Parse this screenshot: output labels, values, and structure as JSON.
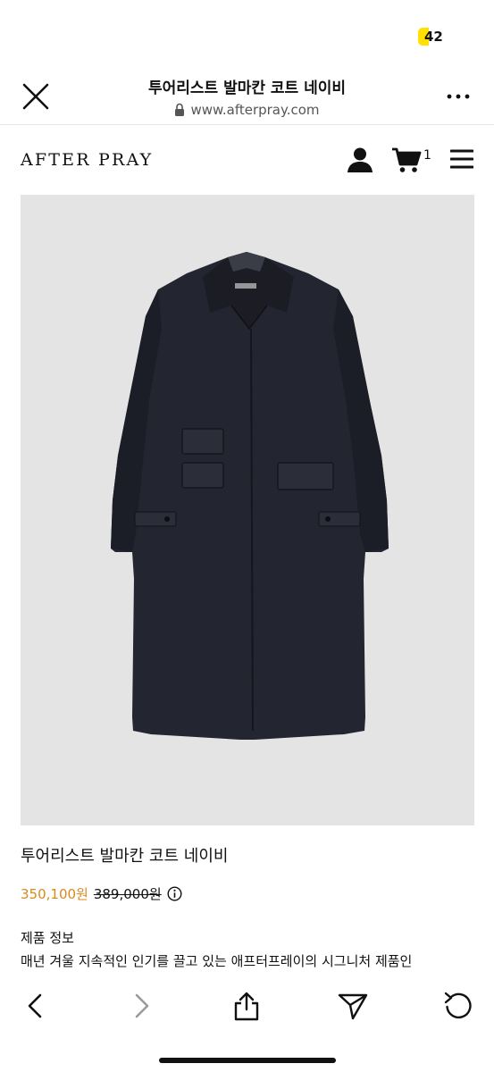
{
  "status": {
    "battery": "42"
  },
  "browser": {
    "title": "투어리스트 발마칸 코트 네이비",
    "url": "www.afterpray.com"
  },
  "site": {
    "brand": "AFTER PRAY",
    "cart_count": "1"
  },
  "product": {
    "name": "투어리스트 발마칸 코트 네이비",
    "sale_price": "350,100원",
    "original_price": "389,000원",
    "section_title": "제품 정보",
    "description": "매년 겨울 지속적인 인기를 끌고 있는 애프터프레이의 시그니처 제품인"
  },
  "colors": {
    "accent_price": "#d98a1c",
    "coat": "#232530",
    "image_bg": "#e4e4e4"
  },
  "icons": [
    "close-icon",
    "more-icon",
    "lock-icon",
    "user-icon",
    "cart-icon",
    "menu-icon",
    "info-icon",
    "back-icon",
    "forward-icon",
    "share-icon",
    "send-icon",
    "refresh-icon"
  ]
}
